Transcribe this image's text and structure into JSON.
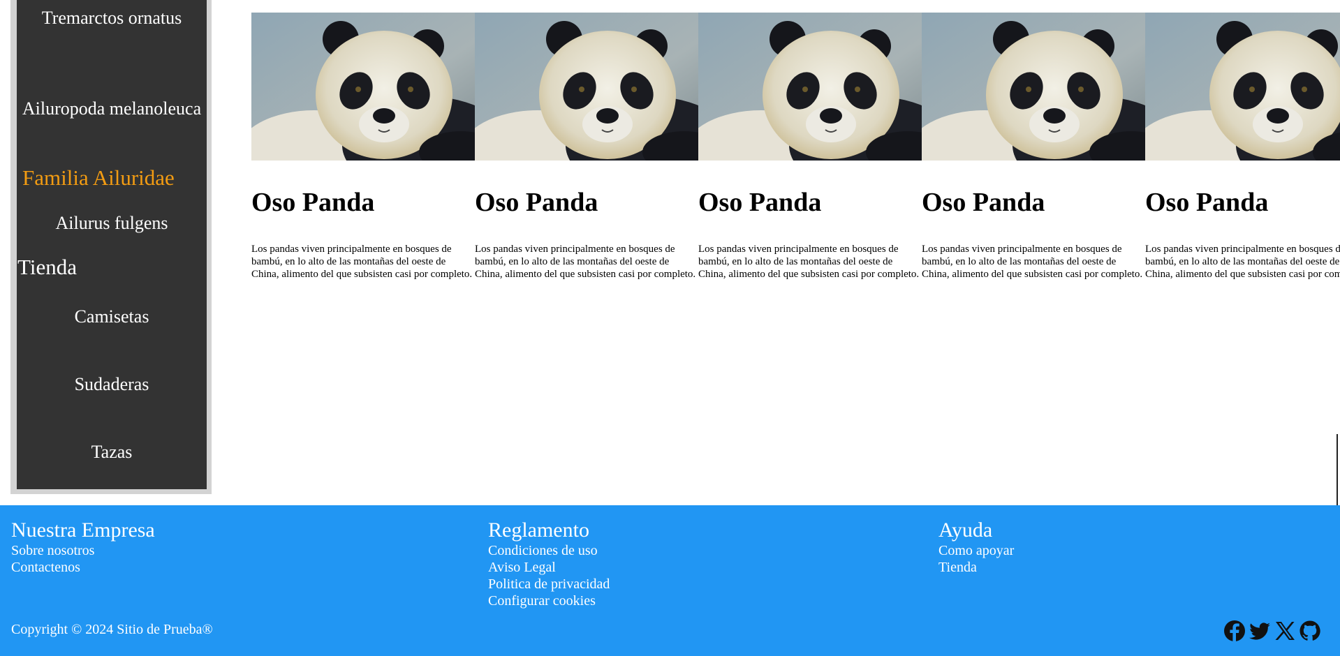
{
  "sidebar": {
    "items": [
      {
        "label": "Tremarctos ornatus",
        "type": "item"
      },
      {
        "label": "Ailuropoda melanoleuca",
        "type": "item"
      },
      {
        "label": "Familia Ailuridae",
        "type": "section",
        "accent": true
      },
      {
        "label": "Ailurus fulgens",
        "type": "item"
      },
      {
        "label": "Tienda",
        "type": "section",
        "accent": false
      },
      {
        "label": "Camisetas",
        "type": "item"
      },
      {
        "label": "Sudaderas",
        "type": "item"
      },
      {
        "label": "Tazas",
        "type": "item"
      }
    ],
    "accent_color": "#f39c12"
  },
  "cards": [
    {
      "title": "Oso Panda",
      "text": "Los pandas viven principalmente en bosques de bambú, en lo alto de las montañas del oeste de China, alimento del que subsisten casi por completo.",
      "image": "giant-panda-photo"
    },
    {
      "title": "Oso Panda",
      "text": "Los pandas viven principalmente en bosques de bambú, en lo alto de las montañas del oeste de China, alimento del que subsisten casi por completo.",
      "image": "giant-panda-photo"
    },
    {
      "title": "Oso Panda",
      "text": "Los pandas viven principalmente en bosques de bambú, en lo alto de las montañas del oeste de China, alimento del que subsisten casi por completo.",
      "image": "giant-panda-photo"
    },
    {
      "title": "Oso Panda",
      "text": "Los pandas viven principalmente en bosques de bambú, en lo alto de las montañas del oeste de China, alimento del que subsisten casi por completo.",
      "image": "giant-panda-photo"
    },
    {
      "title": "Oso Panda",
      "text": "Los pandas viven principalmente en bosques de bambú, en lo alto de las montañas del oeste de China, alimento del que subsisten casi por completo.",
      "image": "giant-panda-photo"
    }
  ],
  "footer": {
    "background": "#2196f3",
    "columns": [
      {
        "heading": "Nuestra Empresa",
        "links": [
          "Sobre nosotros",
          "Contactenos"
        ]
      },
      {
        "heading": "Reglamento",
        "links": [
          "Condiciones de uso",
          "Aviso Legal",
          "Politica de privacidad",
          "Configurar cookies"
        ]
      },
      {
        "heading": "Ayuda",
        "links": [
          "Como apoyar",
          "Tienda"
        ]
      }
    ],
    "copyright": "Copyright © 2024 Sitio de Prueba®",
    "socials": [
      "facebook-icon",
      "twitter-bird-icon",
      "x-icon",
      "github-icon"
    ]
  }
}
